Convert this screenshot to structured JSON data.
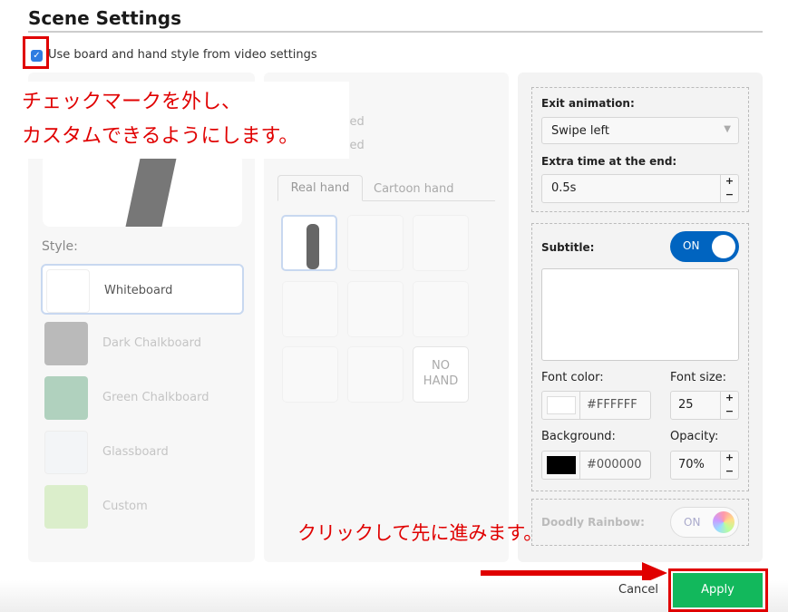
{
  "title": "Scene Settings",
  "use_video_settings": {
    "label": "Use board and hand style from video settings",
    "checked": true
  },
  "style": {
    "label": "Style:",
    "items": [
      "Whiteboard",
      "Dark Chalkboard",
      "Green Chalkboard",
      "Glassboard",
      "Custom"
    ],
    "selected": "Whiteboard",
    "colors": [
      "#ffffff",
      "#4a4a4a",
      "#2e8b57",
      "#f4f6fa",
      "#a8e07a"
    ]
  },
  "hand": {
    "label_fragment": "e:",
    "option_fragments": [
      "nded",
      "nded"
    ],
    "tabs": [
      "Real hand",
      "Cartoon hand"
    ],
    "active_tab": "Real hand",
    "no_hand": "NO HAND"
  },
  "exit_animation": {
    "label": "Exit animation:",
    "value": "Swipe left"
  },
  "extra_time": {
    "label": "Extra time at the end:",
    "value": "0.5s"
  },
  "subtitle": {
    "label": "Subtitle:",
    "toggle": "ON",
    "text": ""
  },
  "font_color": {
    "label": "Font color:",
    "value": "#FFFFFF"
  },
  "font_size": {
    "label": "Font size:",
    "value": "25"
  },
  "background": {
    "label": "Background:",
    "value": "#000000"
  },
  "opacity": {
    "label": "Opacity:",
    "value": "70%"
  },
  "rainbow": {
    "label": "Doodly Rainbow:",
    "toggle": "ON"
  },
  "buttons": {
    "cancel": "Cancel",
    "apply": "Apply"
  },
  "annotations": {
    "line1": "チェックマークを外し、",
    "line2": "カスタムできるようにします。",
    "apply_note": "クリックして先に進みます。"
  },
  "colors": {
    "accent": "#0064c0",
    "apply": "#12b85c",
    "annotation": "#e00000"
  }
}
